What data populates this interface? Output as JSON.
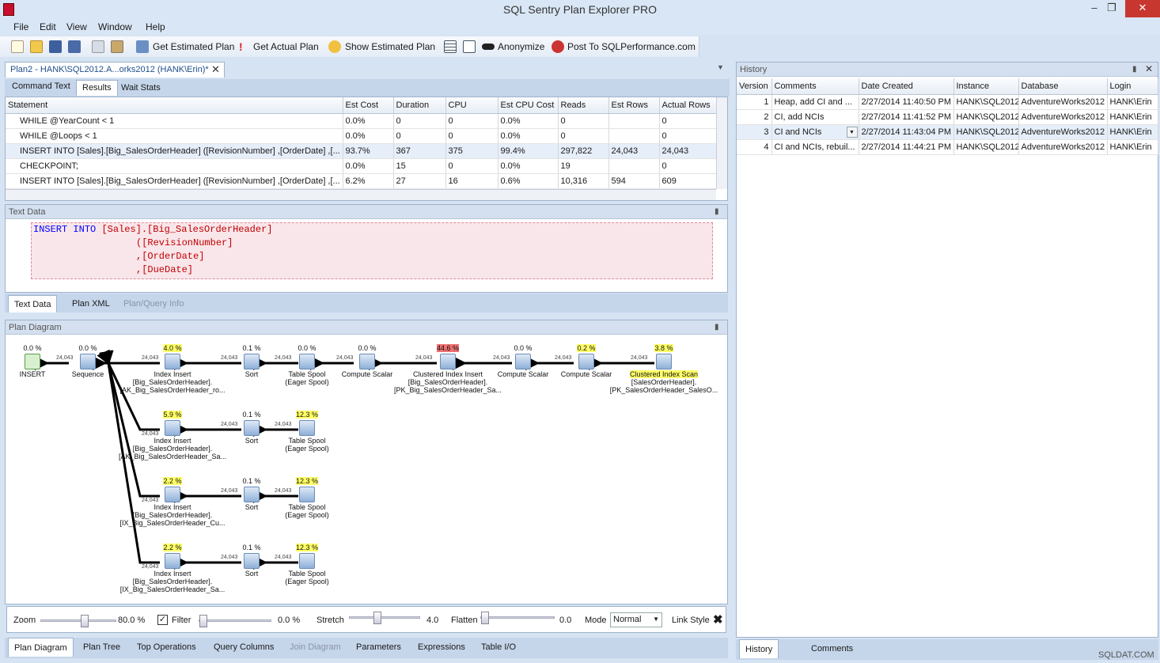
{
  "app": {
    "title": "SQL Sentry Plan Explorer PRO"
  },
  "menu": [
    "File",
    "Edit",
    "View",
    "Window",
    "Help"
  ],
  "toolbar": {
    "est_plan": "Get Estimated Plan",
    "actual_plan": "Get Actual Plan",
    "show_est": "Show Estimated Plan",
    "anonymize": "Anonymize",
    "post": "Post To SQLPerformance.com"
  },
  "doc_tab": "Plan2 - HANK\\SQL2012.A...orks2012 (HANK\\Erin)*",
  "upper_tabs": [
    "Command Text",
    "Results",
    "Wait Stats"
  ],
  "results": {
    "columns": [
      "Statement",
      "Est Cost",
      "Duration",
      "CPU",
      "Est CPU Cost",
      "Reads",
      "Est Rows",
      "Actual Rows"
    ],
    "rows": [
      [
        "WHILE @YearCount < 1",
        "0.0%",
        "0",
        "0",
        "0.0%",
        "0",
        "",
        "0"
      ],
      [
        "WHILE @Loops < 1",
        "0.0%",
        "0",
        "0",
        "0.0%",
        "0",
        "",
        "0"
      ],
      [
        "INSERT INTO [Sales].[Big_SalesOrderHeader] ([RevisionNumber] ,[OrderDate] ,[...",
        "93.7%",
        "367",
        "375",
        "99.4%",
        "297,822",
        "24,043",
        "24,043"
      ],
      [
        "CHECKPOINT;",
        "0.0%",
        "15",
        "0",
        "0.0%",
        "19",
        "",
        "0"
      ],
      [
        "INSERT INTO [Sales].[Big_SalesOrderHeader] ([RevisionNumber] ,[OrderDate] ,[...",
        "6.2%",
        "27",
        "16",
        "0.6%",
        "10,316",
        "594",
        "609"
      ]
    ]
  },
  "text_data": {
    "header": "Text Data",
    "line1_kw1": "INSERT",
    "line1_kw2": "INTO",
    "line1_rest": "[Sales].[Big_SalesOrderHeader]",
    "line2": "([RevisionNumber]",
    "line3": ",[OrderDate]",
    "line4": ",[DueDate]"
  },
  "mid_tabs": [
    "Text Data",
    "Plan XML",
    "Plan/Query Info"
  ],
  "plan": {
    "header": "Plan Diagram",
    "rowcount": "24,043",
    "nodes": [
      {
        "id": "insert",
        "pct": "0.0 %",
        "label": [
          "INSERT"
        ]
      },
      {
        "id": "sequence",
        "pct": "0.0 %",
        "label": [
          "Sequence"
        ]
      },
      {
        "id": "ii1",
        "pct": "4.0 %",
        "label": [
          "Index Insert",
          "[Big_SalesOrderHeader].",
          "[AK_Big_SalesOrderHeader_ro..."
        ]
      },
      {
        "id": "sort1",
        "pct": "0.1 %",
        "label": [
          "Sort"
        ]
      },
      {
        "id": "ts1",
        "pct": "0.0 %",
        "label": [
          "Table Spool",
          "(Eager Spool)"
        ]
      },
      {
        "id": "cs1",
        "pct": "0.0 %",
        "label": [
          "Compute Scalar"
        ]
      },
      {
        "id": "cii",
        "pct": "44.6 %",
        "label": [
          "Clustered Index Insert",
          "[Big_SalesOrderHeader].",
          "[PK_Big_SalesOrderHeader_Sa..."
        ]
      },
      {
        "id": "cs2",
        "pct": "0.0 %",
        "label": [
          "Compute Scalar"
        ]
      },
      {
        "id": "cs3",
        "pct": "0.2 %",
        "label": [
          "Compute Scalar"
        ]
      },
      {
        "id": "cis",
        "pct": "3.8 %",
        "label": [
          "Clustered Index Scan",
          "[SalesOrderHeader].",
          "[PK_SalesOrderHeader_SalesO..."
        ]
      },
      {
        "id": "ii2",
        "pct": "5.9 %",
        "label": [
          "Index Insert",
          "[Big_SalesOrderHeader].",
          "[AK_Big_SalesOrderHeader_Sa..."
        ]
      },
      {
        "id": "sort2",
        "pct": "0.1 %",
        "label": [
          "Sort"
        ]
      },
      {
        "id": "ts2",
        "pct": "12.3 %",
        "label": [
          "Table Spool",
          "(Eager Spool)"
        ]
      },
      {
        "id": "ii3",
        "pct": "2.2 %",
        "label": [
          "Index Insert",
          "[Big_SalesOrderHeader].",
          "[IX_Big_SalesOrderHeader_Cu..."
        ]
      },
      {
        "id": "sort3",
        "pct": "0.1 %",
        "label": [
          "Sort"
        ]
      },
      {
        "id": "ts3",
        "pct": "12.3 %",
        "label": [
          "Table Spool",
          "(Eager Spool)"
        ]
      },
      {
        "id": "ii4",
        "pct": "2.2 %",
        "label": [
          "Index Insert",
          "[Big_SalesOrderHeader].",
          "[IX_Big_SalesOrderHeader_Sa..."
        ]
      },
      {
        "id": "sort4",
        "pct": "0.1 %",
        "label": [
          "Sort"
        ]
      },
      {
        "id": "ts4",
        "pct": "12.3 %",
        "label": [
          "Table Spool",
          "(Eager Spool)"
        ]
      }
    ]
  },
  "controls": {
    "zoom_label": "Zoom",
    "zoom_val": "80.0 %",
    "filter_label": "Filter",
    "filter_val": "0.0 %",
    "stretch_label": "Stretch",
    "stretch_val": "4.0",
    "flatten_label": "Flatten",
    "flatten_val": "0.0",
    "mode_label": "Mode",
    "mode_val": "Normal",
    "linkstyle_label": "Link Style"
  },
  "bottom_tabs": [
    "Plan Diagram",
    "Plan Tree",
    "Top Operations",
    "Query Columns",
    "Join Diagram",
    "Parameters",
    "Expressions",
    "Table I/O"
  ],
  "history": {
    "header": "History",
    "columns": [
      "Version",
      "Comments",
      "Date Created",
      "Instance",
      "Database",
      "Login"
    ],
    "rows": [
      [
        "1",
        "Heap, add CI and ...",
        "2/27/2014 11:40:50 PM",
        "HANK\\SQL2012",
        "AdventureWorks2012",
        "HANK\\Erin"
      ],
      [
        "2",
        "CI, add NCIs",
        "2/27/2014 11:41:52 PM",
        "HANK\\SQL2012",
        "AdventureWorks2012",
        "HANK\\Erin"
      ],
      [
        "3",
        "CI and NCIs",
        "2/27/2014 11:43:04 PM",
        "HANK\\SQL2012",
        "AdventureWorks2012",
        "HANK\\Erin"
      ],
      [
        "4",
        "CI and NCIs, rebuil...",
        "2/27/2014 11:44:21 PM",
        "HANK\\SQL2012",
        "AdventureWorks2012",
        "HANK\\Erin"
      ]
    ],
    "tabs": [
      "History",
      "Comments"
    ]
  },
  "watermark": "SQLDAT.COM"
}
